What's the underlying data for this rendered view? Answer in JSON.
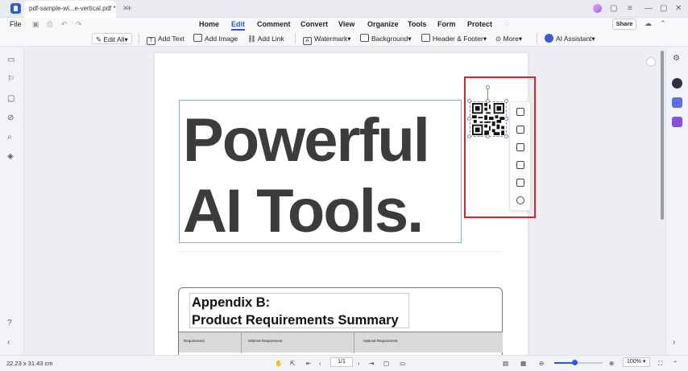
{
  "window": {
    "tab_title": "pdf-sample-wi...e-vertical.pdf *",
    "tab_close": "✕",
    "tab_add": "+"
  },
  "menu": {
    "file": "File",
    "items": [
      "Home",
      "Edit",
      "Comment",
      "Convert",
      "View",
      "Organize",
      "Tools",
      "Form",
      "Protect"
    ],
    "active": "Edit",
    "share": "Share"
  },
  "toolbar": {
    "edit_all": "Edit All",
    "add_text": "Add Text",
    "add_image": "Add Image",
    "add_link": "Add Link",
    "watermark": "Watermark",
    "background": "Background",
    "header_footer": "Header & Footer",
    "more": "More",
    "ai_assistant": "AI Assistant"
  },
  "document": {
    "heading_line1": "Powerful",
    "heading_line2": "AI Tools.",
    "appendix_line1": "Appendix B:",
    "appendix_line2": "Product Requirements Summary",
    "table_headers": [
      "Requirement",
      "Minimal Requirement",
      "Optimal Requirement"
    ]
  },
  "status": {
    "dimensions": "22.23 x 31.43 cm",
    "page": "1/1",
    "zoom": "100%",
    "zoom_fraction": 0.42
  },
  "colors": {
    "accent": "#2d5bd6",
    "highlight_border": "#d9232d"
  }
}
